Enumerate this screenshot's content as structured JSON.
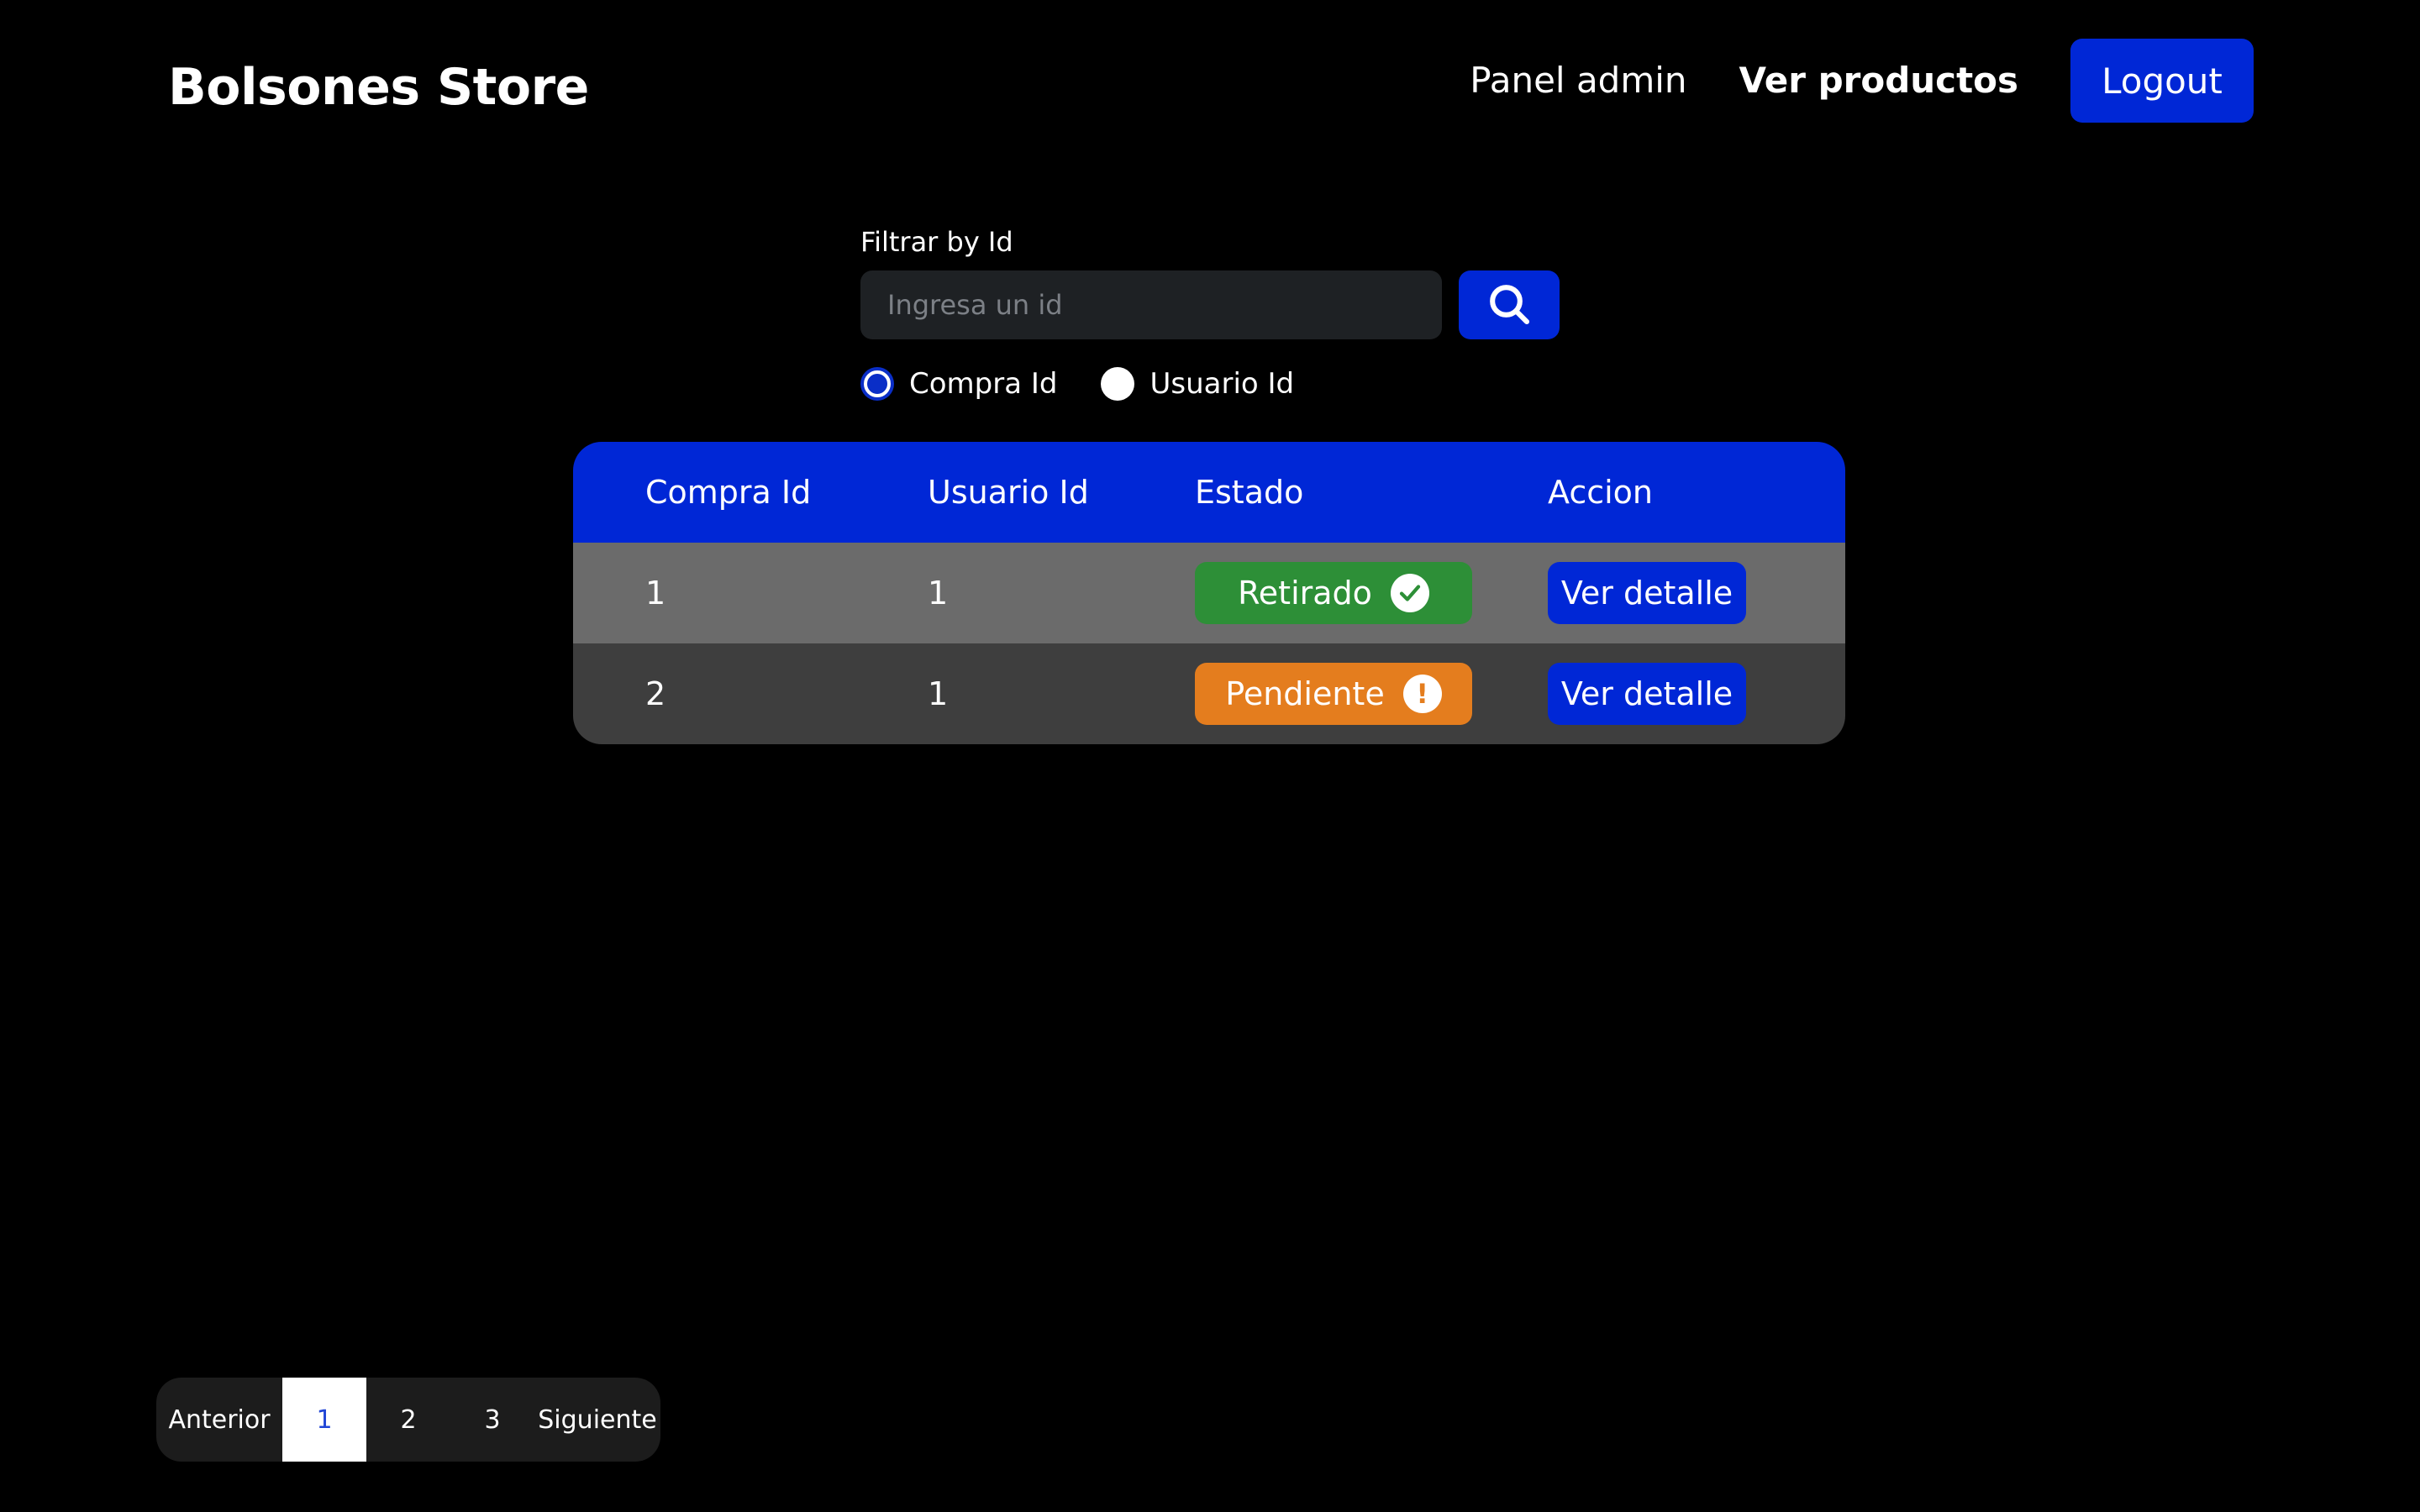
{
  "header": {
    "brand": "Bolsones Store",
    "nav": {
      "panel_admin": "Panel admin",
      "ver_productos": "Ver productos",
      "logout": "Logout"
    }
  },
  "filter": {
    "label": "Filtrar by Id",
    "placeholder": "Ingresa un id",
    "value": "",
    "search_icon": "search-icon",
    "options": [
      {
        "label": "Compra Id",
        "checked": true
      },
      {
        "label": "Usuario Id",
        "checked": false
      }
    ]
  },
  "table": {
    "columns": [
      "Compra Id",
      "Usuario Id",
      "Estado",
      "Accion"
    ],
    "rows": [
      {
        "compra_id": "1",
        "usuario_id": "1",
        "estado": "Retirado",
        "estado_icon": "check-circle-icon",
        "action": "Ver detalle"
      },
      {
        "compra_id": "2",
        "usuario_id": "1",
        "estado": "Pendiente",
        "estado_icon": "exclamation-circle-icon",
        "action": "Ver detalle"
      }
    ]
  },
  "pagination": {
    "prev": "Anterior",
    "pages": [
      "1",
      "2",
      "3"
    ],
    "active_page": "1",
    "next": "Siguiente"
  },
  "colors": {
    "accent": "#0027d6",
    "success": "#2d8f37",
    "warning": "#e47d1e",
    "background": "#000000"
  }
}
